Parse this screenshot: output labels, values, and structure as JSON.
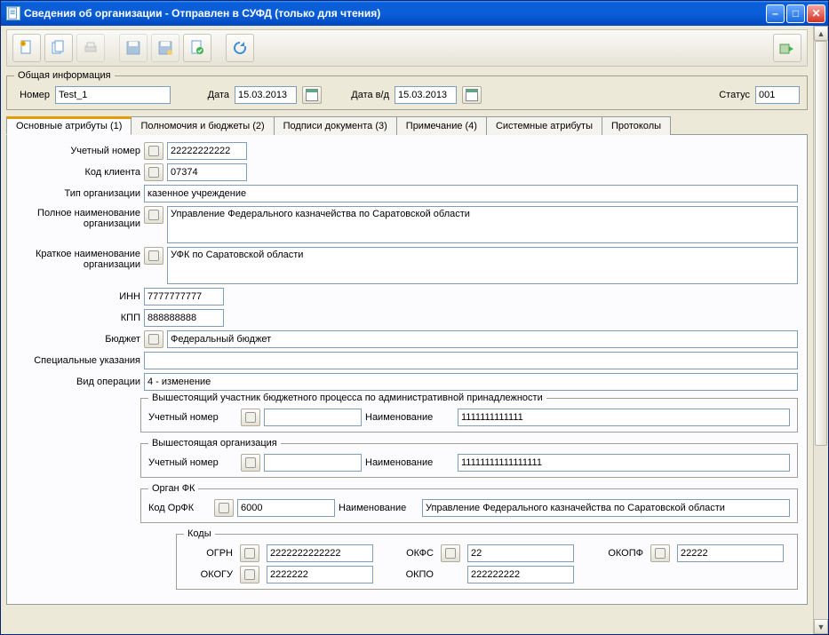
{
  "window": {
    "title": "Сведения об организации - Отправлен в СУФД (только для чтения)"
  },
  "general": {
    "legend": "Общая информация",
    "number_label": "Номер",
    "number_value": "Test_1",
    "date_label": "Дата",
    "date_value": "15.03.2013",
    "date_vd_label": "Дата в/д",
    "date_vd_value": "15.03.2013",
    "status_label": "Статус",
    "status_value": "001"
  },
  "tabs": [
    "Основные атрибуты (1)",
    "Полномочия и бюджеты (2)",
    "Подписи документа (3)",
    "Примечание (4)",
    "Системные атрибуты",
    "Протоколы"
  ],
  "main": {
    "account_number_label": "Учетный номер",
    "account_number": "22222222222",
    "client_code_label": "Код клиента",
    "client_code": "07374",
    "org_type_label": "Тип организации",
    "org_type": "казенное учреждение",
    "full_name_label": "Полное наименование организации",
    "full_name": "Управление Федерального казначейства по Саратовской области",
    "short_name_label": "Краткое наименование организации",
    "short_name": "УФК по Саратовской области",
    "inn_label": "ИНН",
    "inn": "7777777777",
    "kpp_label": "КПП",
    "kpp": "888888888",
    "budget_label": "Бюджет",
    "budget": "Федеральный бюджет",
    "special_label": "Специальные указания",
    "special": "",
    "operation_label": "Вид операции",
    "operation": "4 - изменение"
  },
  "parent1": {
    "legend": "Вышестоящий участник бюджетного процесса по административной принадлежности",
    "acct_label": "Учетный номер",
    "acct": "",
    "name_label": "Наименование",
    "name": "1111111111111"
  },
  "parent2": {
    "legend": "Вышестоящая организация",
    "acct_label": "Учетный номер",
    "acct": "",
    "name_label": "Наименование",
    "name": "11111111111111111"
  },
  "organfk": {
    "legend": "Орган ФК",
    "code_label": "Код ОрФК",
    "code": "6000",
    "name_label": "Наименование",
    "name": "Управление Федерального казначейства по Саратовской области"
  },
  "codes": {
    "legend": "Коды",
    "ogrn_label": "ОГРН",
    "ogrn": "2222222222222",
    "okfs_label": "ОКФС",
    "okfs": "22",
    "okopf_label": "ОКОПФ",
    "okopf": "22222",
    "okogu_label": "ОКОГУ",
    "okogu": "2222222",
    "okpo_label": "ОКПО",
    "okpo": "222222222"
  }
}
